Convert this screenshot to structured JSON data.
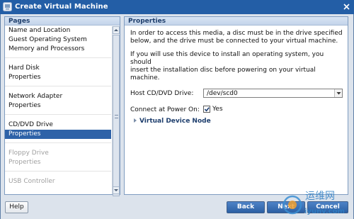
{
  "window": {
    "title": "Create Virtual Machine",
    "close_icon": "close-icon",
    "app_icon": "vm-icon"
  },
  "pages": {
    "header": "Pages",
    "items": [
      {
        "label": "Name and Location",
        "state": "normal"
      },
      {
        "label": "Guest Operating System",
        "state": "normal"
      },
      {
        "label": "Memory and Processors",
        "state": "normal"
      },
      {
        "label": "Hard Disk",
        "state": "normal"
      },
      {
        "label": "Properties",
        "state": "normal"
      },
      {
        "label": "Network Adapter",
        "state": "normal"
      },
      {
        "label": "Properties",
        "state": "normal"
      },
      {
        "label": "CD/DVD Drive",
        "state": "normal"
      },
      {
        "label": "Properties",
        "state": "selected"
      },
      {
        "label": "Floppy Drive",
        "state": "disabled"
      },
      {
        "label": "Properties",
        "state": "disabled"
      },
      {
        "label": "USB Controller",
        "state": "disabled"
      }
    ]
  },
  "properties": {
    "header": "Properties",
    "paragraph1_line1": "In order to access this media, a disc must be in the drive specified",
    "paragraph1_line2": "below, and the drive must be connected to your virtual machine.",
    "paragraph2_line1": "If you will use this device to install an operating system, you should",
    "paragraph2_line2": "insert the installation disc before powering on your virtual machine.",
    "host_drive_label": "Host CD/DVD Drive:",
    "host_drive_value": "/dev/scd0",
    "connect_label": "Connect at Power On:",
    "connect_checked": true,
    "connect_value_label": "Yes",
    "section_label": "Virtual Device Node"
  },
  "buttons": {
    "help": "Help",
    "back": "Back",
    "next": "Next",
    "cancel": "Cancel"
  },
  "watermark": {
    "text_top": "运维网",
    "text_bottom": "iyunv.com"
  },
  "colors": {
    "titlebar": "#235ea6",
    "selection": "#2e62a8",
    "primary_button": "#2b5fa3",
    "section_text": "#1e3e6d"
  }
}
